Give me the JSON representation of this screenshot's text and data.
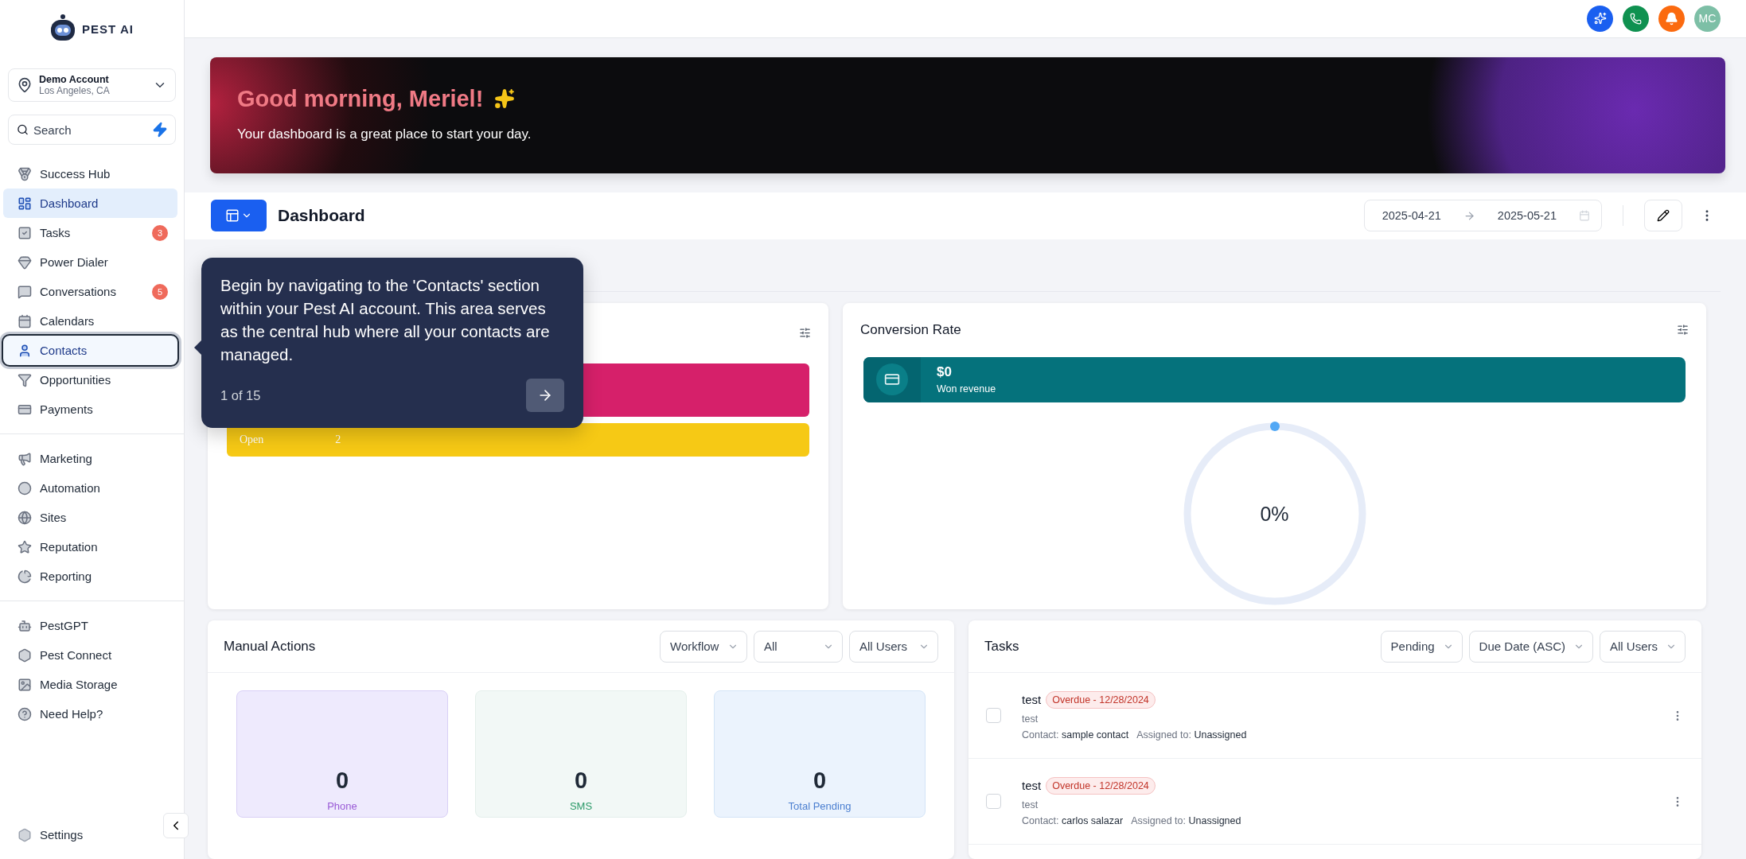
{
  "brand": {
    "name": "PEST AI"
  },
  "account": {
    "name": "Demo Account",
    "location": "Los Angeles, CA"
  },
  "search": {
    "placeholder": "Search"
  },
  "sidebar": {
    "groups": [
      {
        "items": [
          {
            "label": "Success Hub",
            "selected": false,
            "spotlight": false
          },
          {
            "label": "Dashboard",
            "selected": true,
            "spotlight": false
          },
          {
            "label": "Tasks",
            "selected": false,
            "spotlight": false,
            "badge": "3"
          },
          {
            "label": "Power Dialer",
            "selected": false,
            "spotlight": false
          },
          {
            "label": "Conversations",
            "selected": false,
            "spotlight": false,
            "badge": "5"
          },
          {
            "label": "Calendars",
            "selected": false,
            "spotlight": false
          },
          {
            "label": "Contacts",
            "selected": false,
            "spotlight": true
          },
          {
            "label": "Opportunities",
            "selected": false,
            "spotlight": false
          },
          {
            "label": "Payments",
            "selected": false,
            "spotlight": false
          }
        ]
      },
      {
        "items": [
          {
            "label": "Marketing",
            "selected": false,
            "spotlight": false
          },
          {
            "label": "Automation",
            "selected": false,
            "spotlight": false
          },
          {
            "label": "Sites",
            "selected": false,
            "spotlight": false
          },
          {
            "label": "Reputation",
            "selected": false,
            "spotlight": false
          },
          {
            "label": "Reporting",
            "selected": false,
            "spotlight": false
          }
        ]
      },
      {
        "items": [
          {
            "label": "PestGPT",
            "selected": false,
            "spotlight": false
          },
          {
            "label": "Pest Connect",
            "selected": false,
            "spotlight": false
          },
          {
            "label": "Media Storage",
            "selected": false,
            "spotlight": false
          },
          {
            "label": "Need Help?",
            "selected": false,
            "spotlight": false
          }
        ]
      }
    ],
    "footer": {
      "label": "Settings"
    }
  },
  "top_bar": {
    "avatar": "MC"
  },
  "banner": {
    "greeting": "Good morning, Meriel!",
    "subtitle": "Your dashboard is a great place to start your day."
  },
  "dashboard_bar": {
    "title": "Dashboard",
    "date_from": "2025-04-21",
    "date_to": "2025-05-21"
  },
  "tour": {
    "text": "Begin by navigating to the 'Contacts' section within your Pest AI account. This area serves as the central hub where all your contacts are managed.",
    "step": "1 of 15"
  },
  "pipeline_card": {
    "bars": [
      {
        "color": "#d6206a"
      },
      {
        "label": "Open",
        "value": "2",
        "color": "#f6c915"
      }
    ]
  },
  "conversion_card": {
    "title": "Conversion Rate",
    "revenue": "$0",
    "revenue_label": "Won revenue",
    "rate": "0%"
  },
  "manual_actions": {
    "title": "Manual Actions",
    "filters": [
      "Workflow",
      "All",
      "All Users"
    ],
    "stats": [
      {
        "value": "0",
        "label": "Phone",
        "kind": "phone"
      },
      {
        "value": "0",
        "label": "SMS",
        "kind": "sms"
      },
      {
        "value": "0",
        "label": "Total Pending",
        "kind": "total"
      }
    ]
  },
  "tasks": {
    "title": "Tasks",
    "filters": [
      "Pending",
      "Due Date (ASC)",
      "All Users"
    ],
    "rows": [
      {
        "title": "test",
        "status": "Overdue - 12/28/2024",
        "description": "test",
        "contact_label": "Contact:",
        "contact": "sample contact",
        "assigned_label": "Assigned to:",
        "assignee": "Unassigned",
        "checked": false
      },
      {
        "title": "test",
        "status": "Overdue - 12/28/2024",
        "description": "test",
        "contact_label": "Contact:",
        "contact": "carlos salazar",
        "assigned_label": "Assigned to:",
        "assignee": "Unassigned",
        "checked": false
      }
    ]
  }
}
